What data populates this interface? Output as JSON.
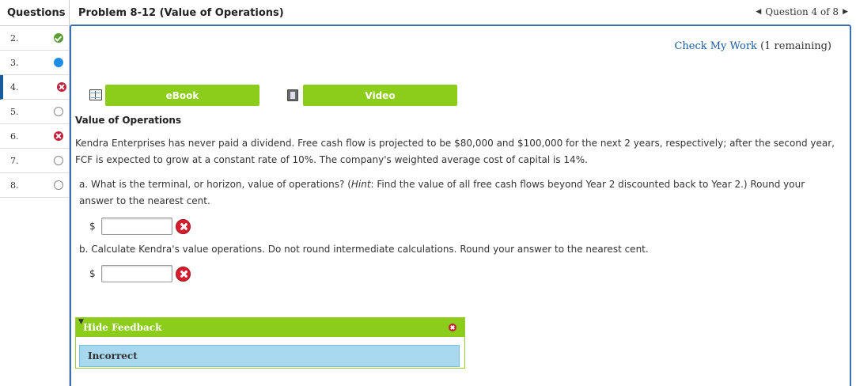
{
  "header": {
    "questions_label": "Questions",
    "problem_title": "Problem 8-12 (Value of Operations)",
    "nav_text": "Question 4 of 8"
  },
  "sidebar": {
    "items": [
      {
        "label": "2.",
        "status": "correct"
      },
      {
        "label": "3.",
        "status": "current"
      },
      {
        "label": "4.",
        "status": "incorrect"
      },
      {
        "label": "5.",
        "status": "unanswered"
      },
      {
        "label": "6.",
        "status": "incorrect"
      },
      {
        "label": "7.",
        "status": "unanswered"
      },
      {
        "label": "8.",
        "status": "unanswered"
      }
    ]
  },
  "main": {
    "check_work_link": "Check My Work",
    "check_work_remaining": "(1 remaining)",
    "ebook_label": "eBook",
    "video_label": "Video",
    "section_title": "Value of Operations",
    "intro": "Kendra Enterprises has never paid a dividend. Free cash flow is projected to be $80,000 and $100,000 for the next 2 years, respectively; after the second year, FCF is expected to grow at a constant rate of 10%. The company's weighted average cost of capital is 14%.",
    "part_a": {
      "prefix": "a. What is the terminal, or horizon, value of operations? (",
      "hint": "Hint",
      "suffix": ": Find the value of all free cash flows beyond Year 2 discounted back to Year 2.) Round your answer to the nearest cent.",
      "currency": "$",
      "value": ""
    },
    "part_b": {
      "text": "b. Calculate Kendra's value operations. Do not round intermediate calculations. Round your answer to the nearest cent.",
      "currency": "$",
      "value": ""
    }
  },
  "feedback": {
    "toggle_label": "Hide Feedback",
    "result": "Incorrect"
  }
}
